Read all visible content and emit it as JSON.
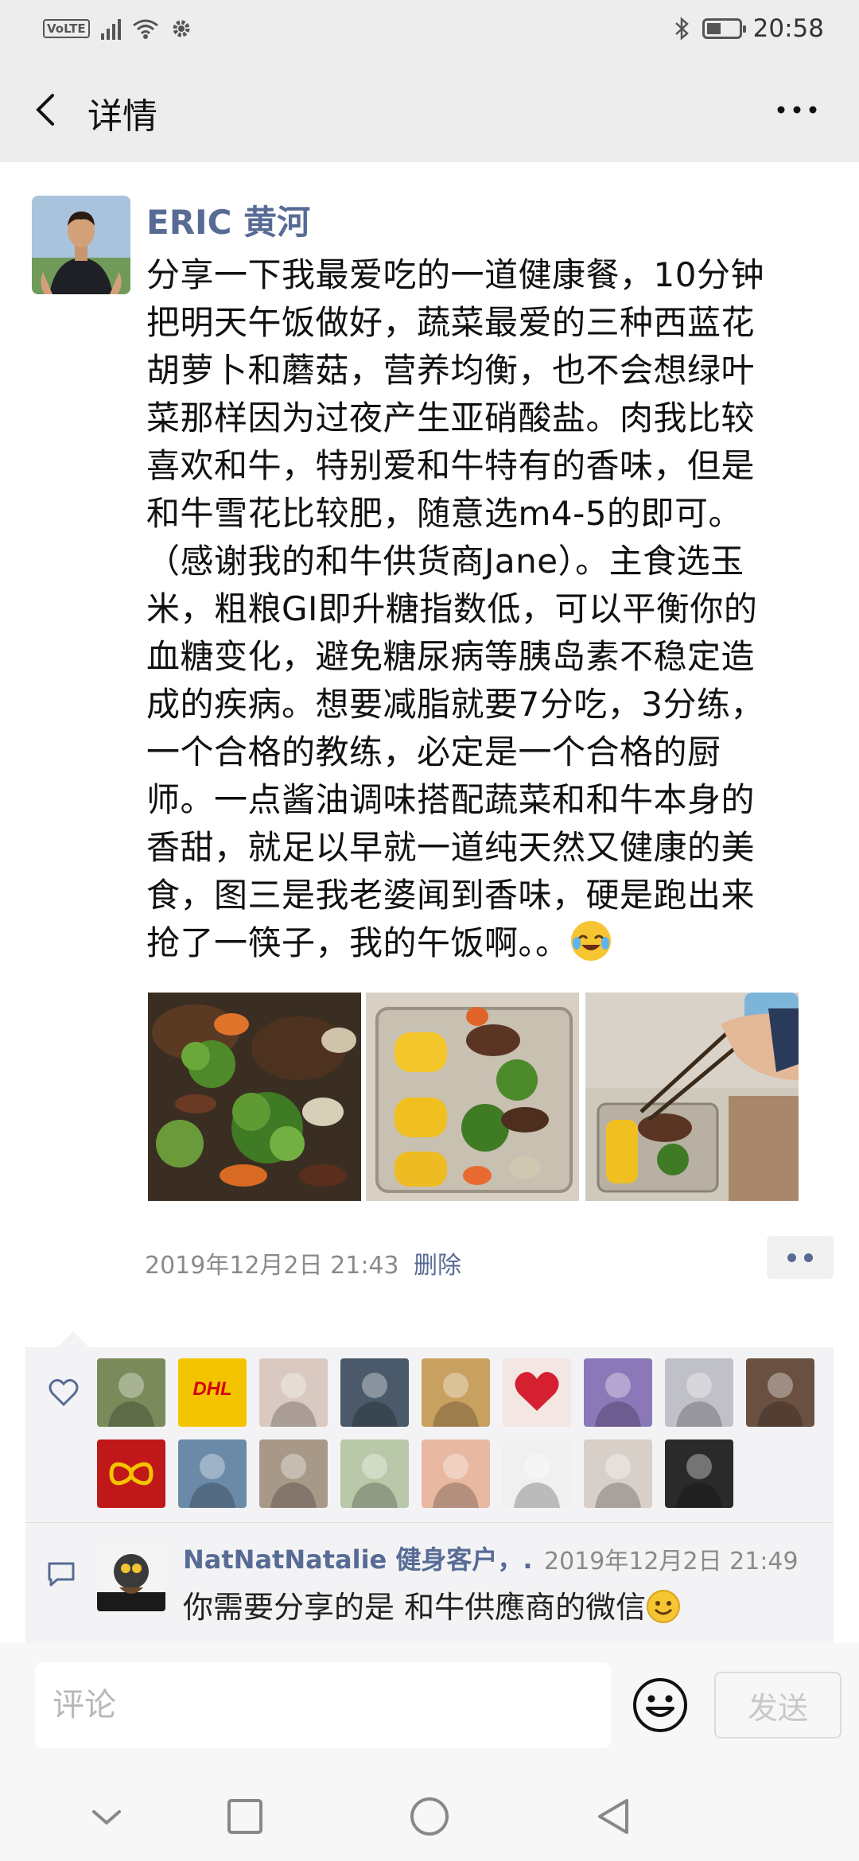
{
  "status_bar": {
    "network_badge": "VoLTE",
    "time": "20:58",
    "icons": [
      "volte-icon",
      "signal-icon",
      "wifi-icon",
      "settings-icon",
      "bluetooth-icon",
      "battery-icon"
    ]
  },
  "header": {
    "title": "详情",
    "back_icon": "chevron-left-icon",
    "more_icon": "more-dots-icon"
  },
  "post": {
    "author": "ERIC 黄河",
    "text_lines": [
      "分享一下我最爱吃的一道健康餐，10分钟",
      "把明天午饭做好，蔬菜最爱的三种西蓝花",
      "胡萝卜和蘑菇，营养均衡，也不会想绿叶",
      "菜那样因为过夜产生亚硝酸盐。肉我比较",
      "喜欢和牛，特别爱和牛特有的香味，但是",
      "和牛雪花比较肥，随意选m4-5的即可。",
      "（感谢我的和牛供货商Jane）。主食选玉",
      "米，粗粮GI即升糖指数低，可以平衡你的",
      "血糖变化，避免糖尿病等胰岛素不稳定造",
      "成的疾病。想要减脂就要7分吃，3分练，",
      "一个合格的教练，必定是一个合格的厨",
      "师。一点酱油调味搭配蔬菜和和牛本身的",
      "香甜，就足以早就一道纯天然又健康的美",
      "食，图三是我老婆闻到香味，硬是跑出来",
      "抢了一筷子，我的午饭啊。。"
    ],
    "photos": [
      "beef-broccoli-stirfry-photo",
      "lunchbox-corn-beef-photo",
      "chopsticks-lunchbox-photo"
    ],
    "timestamp": "2019年12月2日 21:43",
    "delete_label": "删除"
  },
  "likes": {
    "count": 17,
    "colors": [
      "#7a8a5a",
      "#f5c400",
      "#d9c9c0",
      "#4a5a6a",
      "#c8a060",
      "#f0d0d0",
      "#8a78b8",
      "#c0c0c8",
      "#6a5040",
      "#c01818",
      "#6a8aa8",
      "#a89888",
      "#b8c8a8",
      "#e8b8a0",
      "#f0f0f0",
      "#d8d0c8",
      "#2a2a2a"
    ],
    "dhl_label": "DHL"
  },
  "comment": {
    "author": "NatNatNatalie 健身客户，...",
    "time": "2019年12月2日 21:49",
    "text": "你需要分享的是 和牛供應商的微信"
  },
  "input": {
    "placeholder": "评论",
    "send_label": "发送"
  },
  "nav": {
    "icons": [
      "nav-hide-icon",
      "nav-recents-icon",
      "nav-home-icon",
      "nav-back-icon"
    ]
  }
}
